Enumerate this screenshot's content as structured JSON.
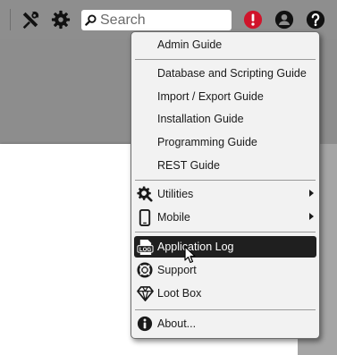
{
  "toolbar": {
    "tools_icon": "tools-icon",
    "settings_icon": "gear-icon",
    "search_placeholder": "Search",
    "alert_icon": "alert-icon",
    "user_icon": "user-icon",
    "help_icon": "help-icon"
  },
  "menu": {
    "items": [
      {
        "label": "Admin Guide"
      },
      {
        "label": "Database and Scripting Guide"
      },
      {
        "label": "Import / Export Guide"
      },
      {
        "label": "Installation Guide"
      },
      {
        "label": "Programming Guide"
      },
      {
        "label": "REST Guide"
      },
      {
        "label": "Utilities",
        "icon": "utilities-icon",
        "submenu": true
      },
      {
        "label": "Mobile",
        "icon": "mobile-icon",
        "submenu": true
      },
      {
        "label": "Application Log",
        "icon": "log-icon",
        "active": true
      },
      {
        "label": "Support",
        "icon": "support-icon"
      },
      {
        "label": "Loot Box",
        "icon": "diamond-icon"
      },
      {
        "label": "About...",
        "icon": "info-icon"
      }
    ]
  },
  "colors": {
    "toolbar_bg": "#8e8e8e",
    "alert": "#d0142b",
    "menu_active_bg": "#1f1f1f",
    "menu_bg": "#f2f2f2"
  }
}
